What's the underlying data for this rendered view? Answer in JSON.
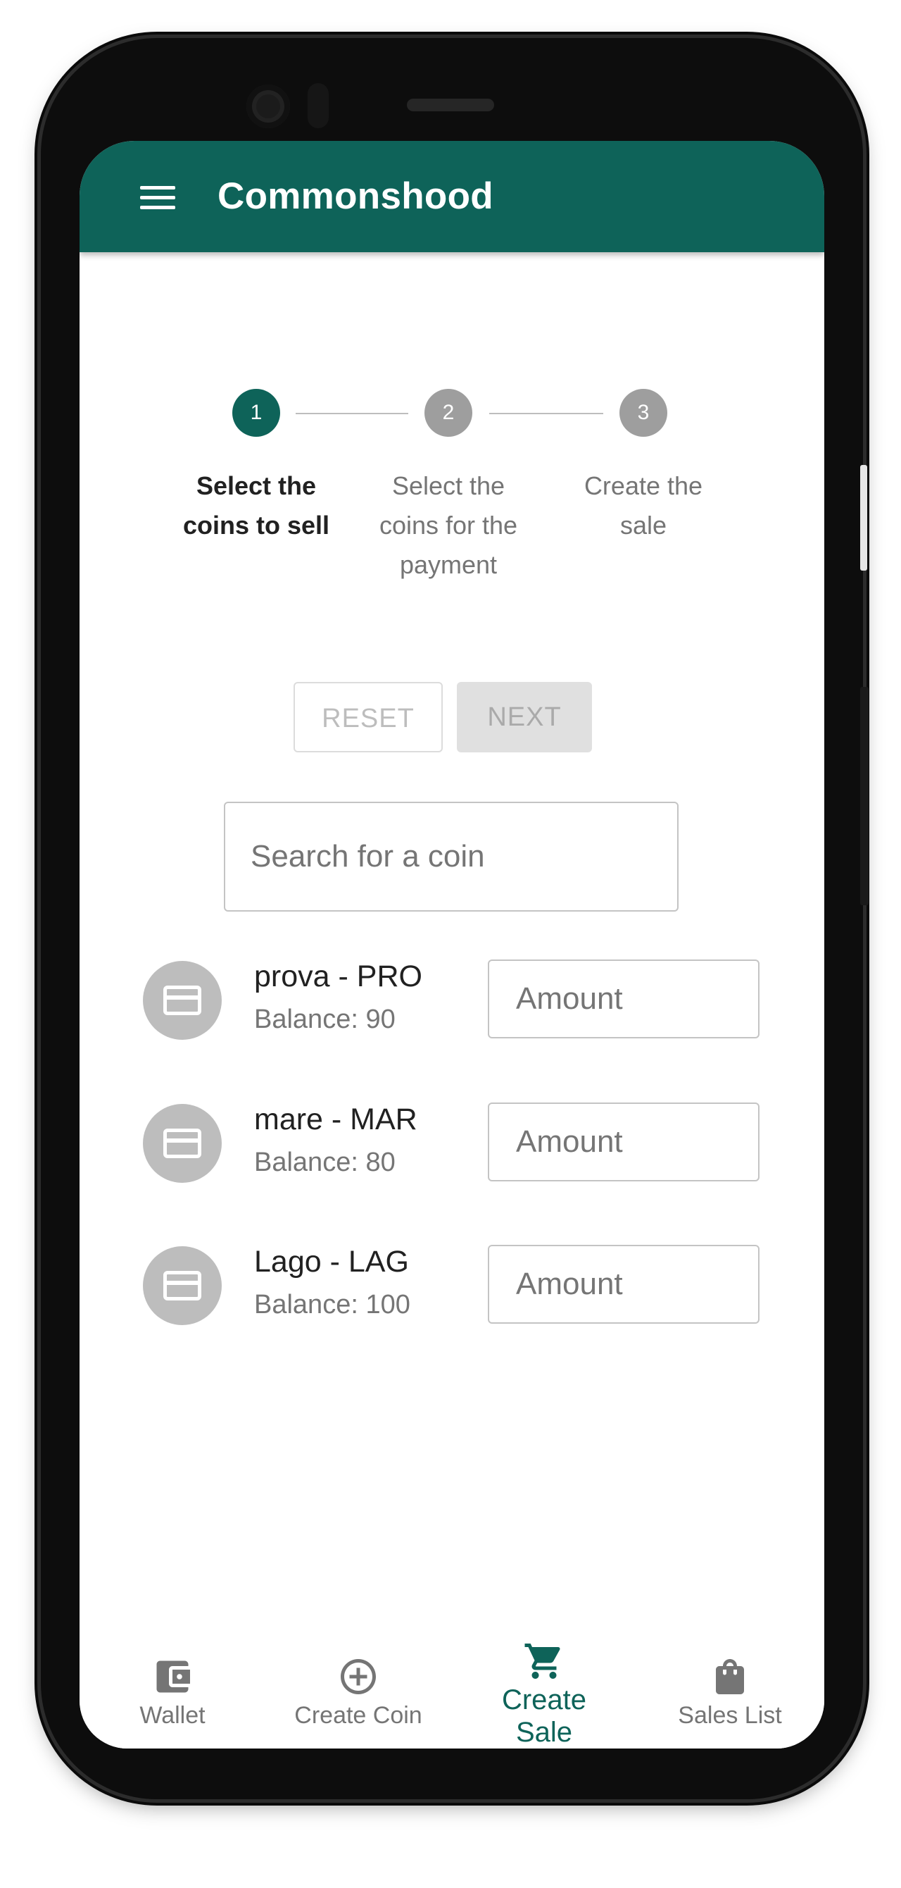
{
  "app": {
    "title": "Commonshood",
    "accent_color": "#0e6359"
  },
  "stepper": {
    "steps": [
      {
        "number": "1",
        "label_line1": "Select the",
        "label_line2": "coins to sell",
        "label_line3": "",
        "active": true
      },
      {
        "number": "2",
        "label_line1": "Select the",
        "label_line2": "coins for the",
        "label_line3": "payment",
        "active": false
      },
      {
        "number": "3",
        "label_line1": "Create the",
        "label_line2": "sale",
        "label_line3": "",
        "active": false
      }
    ]
  },
  "actions": {
    "reset_label": "RESET",
    "next_label": "NEXT"
  },
  "search": {
    "placeholder": "Search for a coin",
    "value": ""
  },
  "coins": [
    {
      "name": "prova - PRO",
      "balance": "Balance: 90",
      "amount_placeholder": "Amount",
      "icon": "credit-card-icon"
    },
    {
      "name": "mare - MAR",
      "balance": "Balance: 80",
      "amount_placeholder": "Amount",
      "icon": "credit-card-icon"
    },
    {
      "name": "Lago - LAG",
      "balance": "Balance: 100",
      "amount_placeholder": "Amount",
      "icon": "credit-card-icon"
    }
  ],
  "bottom_nav": {
    "items": [
      {
        "label": "Wallet",
        "icon": "wallet-icon",
        "active": false
      },
      {
        "label": "Create Coin",
        "icon": "add-circle-icon",
        "active": false
      },
      {
        "label_line1": "Create",
        "label_line2": "Sale",
        "icon": "cart-icon",
        "active": true
      },
      {
        "label": "Sales List",
        "icon": "shopping-bag-icon",
        "active": false
      }
    ]
  }
}
